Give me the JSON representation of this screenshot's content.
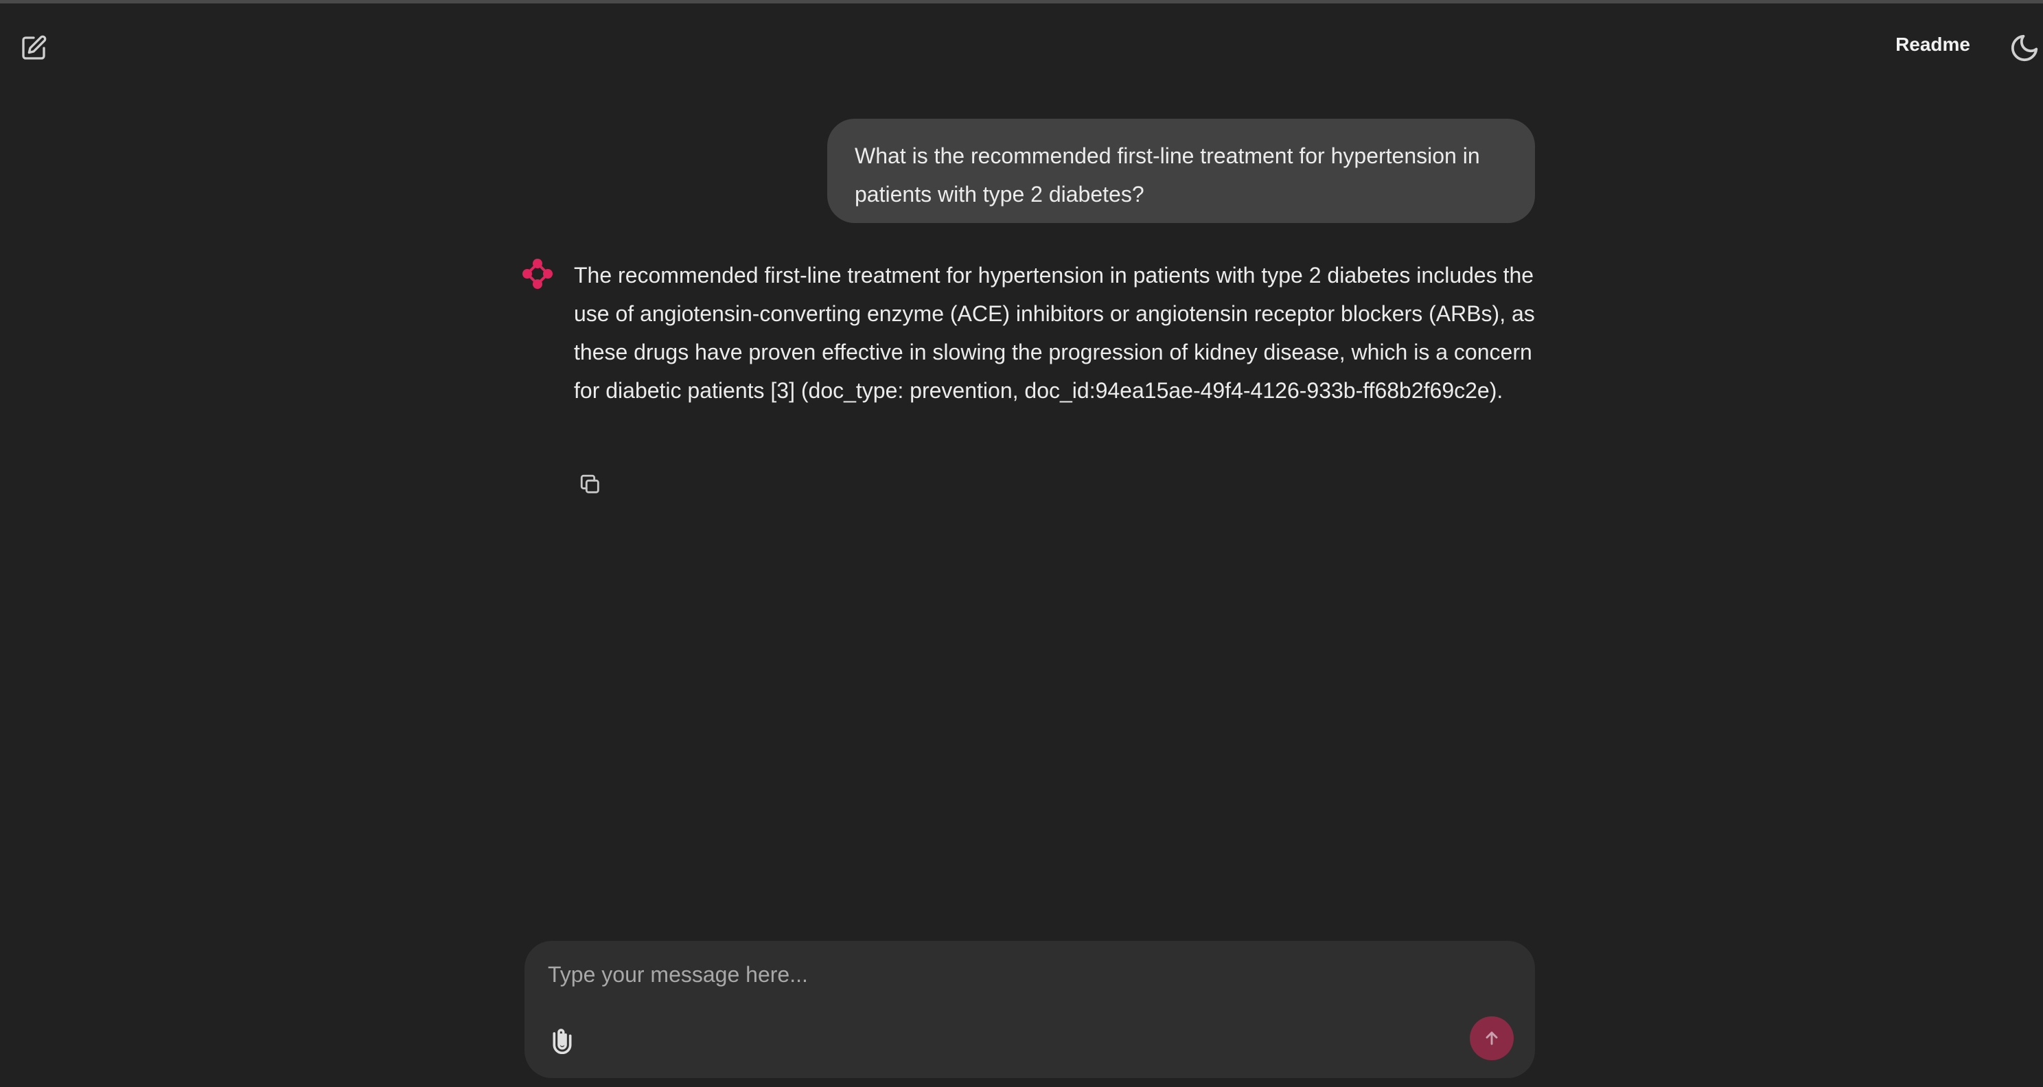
{
  "header": {
    "new_chat_icon": "edit-square-icon",
    "readme_label": "Readme",
    "theme_icon": "moon-icon"
  },
  "conversation": {
    "user_message": "What is the recommended first-line treatment for hypertension in patients with type 2 diabetes?",
    "assistant_message": "The recommended first-line treatment for hypertension in patients with type 2 diabetes includes the use of angiotensin-converting enzyme (ACE) inhibitors or angiotensin receptor blockers (ARBs), as these drugs have proven effective in slowing the progression of kidney disease, which is a concern for diabetic patients [3] (doc_type: prevention, doc_id:94ea15ae-49f4-4126-933b-ff68b2f69c2e).",
    "assistant_avatar_icon": "assistant-logo-icon",
    "copy_icon": "copy-icon"
  },
  "composer": {
    "placeholder": "Type your message here...",
    "attach_icon": "paperclip-icon",
    "send_icon": "arrow-up-icon"
  },
  "colors": {
    "background": "#212121",
    "user_bubble": "#424242",
    "composer": "#2f2f2f",
    "accent": "#e0245e",
    "send_button": "#8a2a44"
  }
}
